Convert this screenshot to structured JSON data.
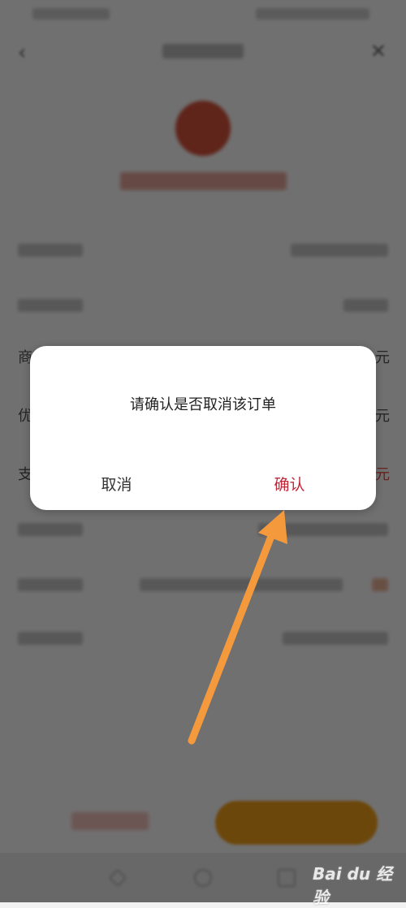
{
  "dialog": {
    "message": "请确认是否取消该订单",
    "cancel_label": "取消",
    "confirm_label": "确认"
  },
  "background_rows": [
    {
      "label_char": "商",
      "value_char": "元"
    },
    {
      "label_char": "优",
      "value_char": "元"
    },
    {
      "label_char": "支",
      "value_char": "元"
    }
  ],
  "watermark": "Bai du 经验",
  "colors": {
    "confirm": "#c0283a",
    "overlay": "rgba(0,0,0,0.56)",
    "annotation_arrow": "#f59a3c",
    "pay_button": "#f6a21b"
  },
  "icons": [
    "back-arrow-icon",
    "close-icon",
    "shop-logo-icon",
    "nav-back-icon",
    "nav-home-icon",
    "nav-recent-icon"
  ]
}
